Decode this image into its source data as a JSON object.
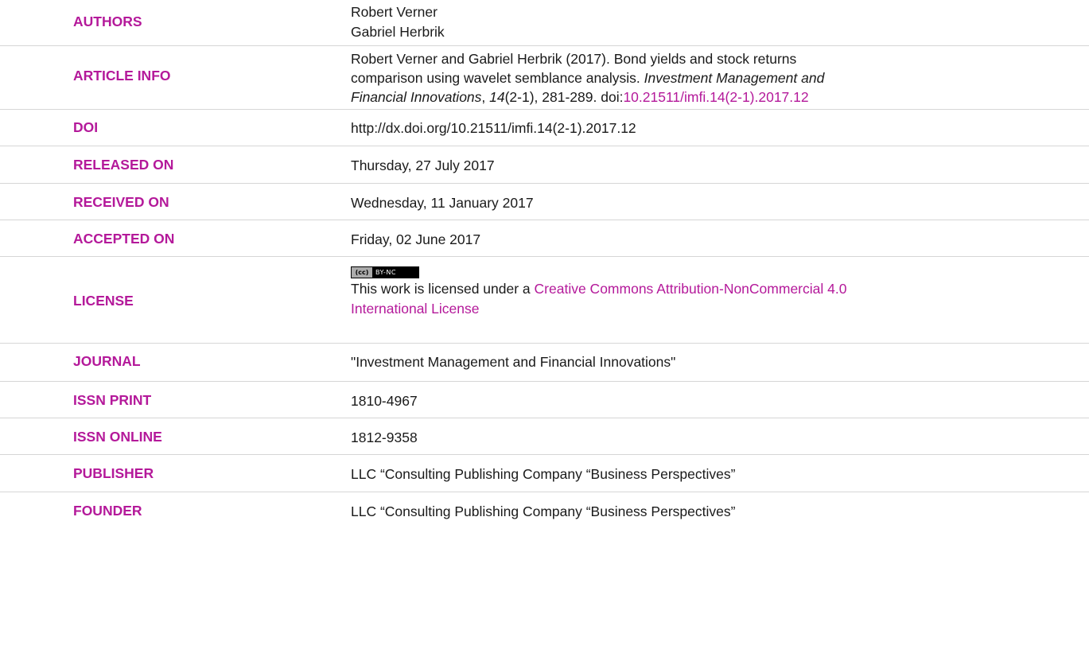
{
  "rows": {
    "authors": {
      "label": "AUTHORS",
      "names": [
        "Robert Verner",
        "Gabriel Herbrik"
      ]
    },
    "article_info": {
      "label": "ARTICLE INFO",
      "line1": "Robert Verner and Gabriel Herbrik (2017). Bond yields and stock returns",
      "line2_plain": "comparison using wavelet semblance analysis. ",
      "line2_italic": "Investment Management and",
      "line3_italic_a": "Financial Innovations",
      "line3_sep": ", ",
      "line3_volume": "14",
      "line3_rest": "(2-1), 281-289. doi:",
      "line3_doi_link": "10.21511/imfi.14(2-1).2017.12"
    },
    "doi": {
      "label": "DOI",
      "value": "http://dx.doi.org/10.21511/imfi.14(2-1).2017.12"
    },
    "released_on": {
      "label": "RELEASED ON",
      "value": "Thursday, 27 July 2017"
    },
    "received_on": {
      "label": "RECEIVED ON",
      "value": "Wednesday, 11 January 2017"
    },
    "accepted_on": {
      "label": "ACCEPTED ON",
      "value": "Friday, 02 June 2017"
    },
    "license": {
      "label": "LICENSE",
      "badge_left": "(cc)",
      "badge_right": "BY-NC",
      "text_prefix": "This work is licensed under a ",
      "link_line1": "Creative Commons Attribution-NonCommercial 4.0",
      "link_line2": "International License"
    },
    "journal": {
      "label": "JOURNAL",
      "value": "\"Investment Management and Financial Innovations\""
    },
    "issn_print": {
      "label": "ISSN PRINT",
      "value": "1810-4967"
    },
    "issn_online": {
      "label": "ISSN ONLINE",
      "value": "1812-9358"
    },
    "publisher": {
      "label": "PUBLISHER",
      "value": "LLC “Consulting Publishing Company “Business Perspectives”"
    },
    "founder": {
      "label": "FOUNDER",
      "value": "LLC “Consulting Publishing Company “Business Perspectives”"
    }
  },
  "colors": {
    "label": "#b4199a",
    "link": "#b4199a",
    "text": "#1a1a1a",
    "divider": "#d6d6d6"
  }
}
